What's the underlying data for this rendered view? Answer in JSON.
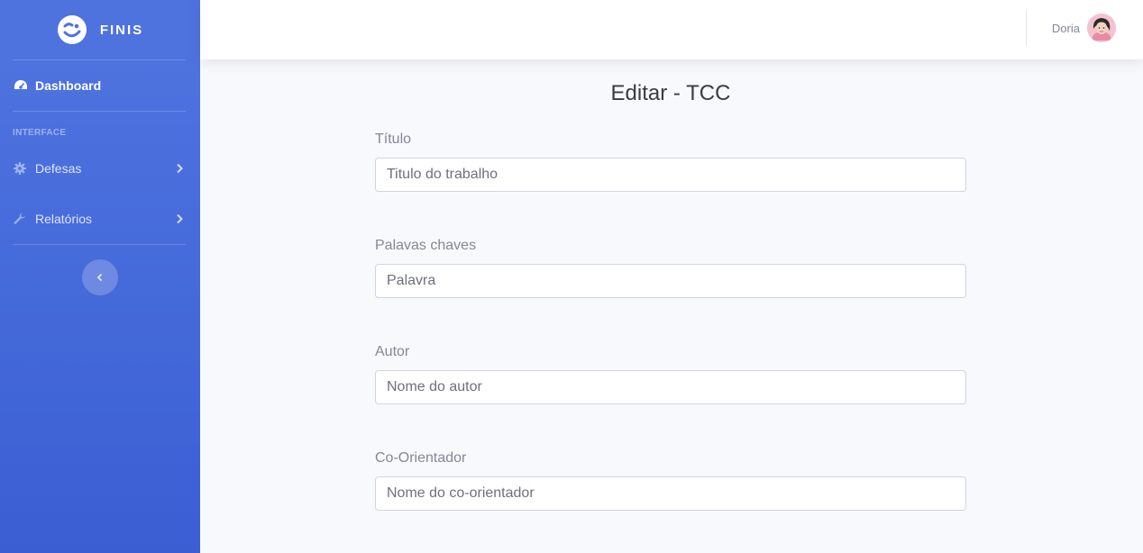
{
  "brand": {
    "name": "FINIS"
  },
  "sidebar": {
    "dashboard_label": "Dashboard",
    "heading": "INTERFACE",
    "items": [
      {
        "label": "Defesas",
        "icon": "gear-icon"
      },
      {
        "label": "Relatórios",
        "icon": "wrench-icon"
      }
    ]
  },
  "topbar": {
    "user_name": "Doria"
  },
  "page": {
    "title": "Editar - TCC"
  },
  "form": {
    "fields": [
      {
        "label": "Título",
        "placeholder": "Titulo do trabalho"
      },
      {
        "label": "Palavas chaves",
        "placeholder": "Palavra"
      },
      {
        "label": "Autor",
        "placeholder": "Nome do autor"
      },
      {
        "label": "Co-Orientador",
        "placeholder": "Nome do co-orientador"
      }
    ]
  },
  "colors": {
    "sidebar_primary": "#4e73df",
    "background": "#f8f9fc",
    "text_muted": "#858796"
  }
}
